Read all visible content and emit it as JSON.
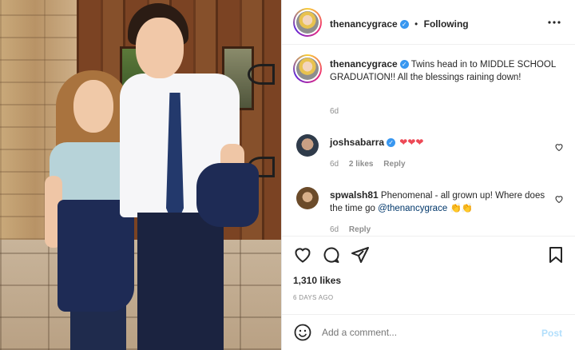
{
  "header": {
    "username": "thenancygrace",
    "separator": "•",
    "follow_status": "Following",
    "more_icon": "more-horizontal-icon"
  },
  "caption": {
    "username": "thenancygrace",
    "text": "Twins head in to MIDDLE SCHOOL GRADUATION!! All the blessings raining down!",
    "age": "6d"
  },
  "comments": [
    {
      "username": "joshsabarra",
      "text": "❤️❤️❤️",
      "hearts": [
        "❤",
        "❤",
        "❤"
      ],
      "age": "6d",
      "likes": "2 likes",
      "reply": "Reply"
    },
    {
      "username": "spwalsh81",
      "text_before_mention": "Phenomenal - all grown up! Where does the time go",
      "mention": "@thenancygrace",
      "emojis": "👏👏",
      "age": "6d",
      "reply": "Reply"
    }
  ],
  "actions": {
    "like_icon": "heart-icon",
    "comment_icon": "comment-icon",
    "share_icon": "share-icon",
    "save_icon": "bookmark-icon"
  },
  "likes": "1,310 likes",
  "timestamp": "6 DAYS AGO",
  "composer": {
    "emoji_icon": "emoji-icon",
    "placeholder": "Add a comment...",
    "post_label": "Post"
  },
  "colors": {
    "verified": "#3897f0",
    "link": "#00376b",
    "post_disabled": "#b2dffc",
    "heart": "#ed4956"
  }
}
